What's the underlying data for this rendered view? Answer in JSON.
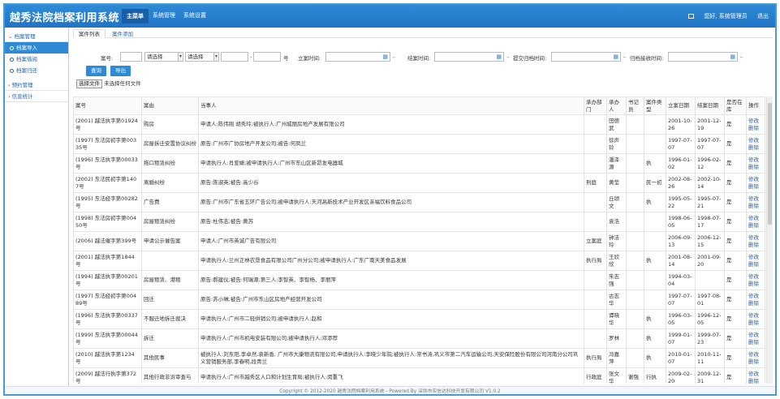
{
  "header": {
    "app_title": "越秀法院档案利用系统",
    "nav": [
      "主菜单",
      "系统管理",
      "系统设置"
    ],
    "greeting": "您好, 系统管理员",
    "logout": "退出"
  },
  "sidebar": {
    "group1": "档案管理",
    "items": [
      "档案导入",
      "档案借阅",
      "档案归还"
    ],
    "group2": "预约管理",
    "group3": "信息统计"
  },
  "tabs": [
    "案件列表",
    "案件添加"
  ],
  "filters": {
    "case_no_label": "案号:",
    "select1": "请选择",
    "select2": "请选择",
    "dash": "-",
    "hao": "号",
    "filing_time_label": "立案时间:",
    "closing_time_label": "结案时间:",
    "submit_archive_label": "提交归档时间:",
    "archive_receive_label": "归档接收时间:",
    "range_sep": "-",
    "query_button": "查询",
    "export_button": "导出"
  },
  "upload": {
    "choose_file": "选择文件",
    "no_file": "未选择任何文件"
  },
  "table": {
    "headers": [
      "案号",
      "案由",
      "当事人",
      "承办部门",
      "承办人",
      "书记员",
      "案件类型",
      "立案日期",
      "结案日期",
      "是否在库",
      "操作"
    ],
    "rows": [
      [
        "(2001) 越法执字第01924号",
        "购房",
        "申请人:陈伟刚 胡秀玲;被执行人:广州城丽房地产发展有限公司",
        "",
        "田德武",
        "",
        "",
        "2001-10-26",
        "2001-12-19",
        "是",
        "修改 删除"
      ],
      [
        "(1997) 东法房初字第00335号",
        "房屋拆迁安置协议纠纷",
        "原告:广州市广协房地产开发公司;被告:何凤兰",
        "",
        "徐声铃",
        "",
        "",
        "1997-07-07",
        "1997-07-07",
        "是",
        "修改 删除"
      ],
      [
        "(1996) 东法执字第00033号",
        "拖口租赁纠纷",
        "申请执行人:肖爱婕;被申请执行人:广州市东山区新昂发电器城",
        "",
        "潘泽源",
        "",
        "执",
        "1996-01-02",
        "1996-02-12",
        "是",
        "修改 删除"
      ],
      [
        "(2002) 东法民初字第1407号",
        "离婚纠纷",
        "原告:陈淑英;被告:高少谷",
        "刑庭",
        "黄莹",
        "",
        "民一初",
        "2002-08-26",
        "2002-10-14",
        "是",
        "修改 删除"
      ],
      [
        "(1995) 东法经字第00282号",
        "广告费",
        "原告:广州市广东省五环广告公司;被申请执行人:天河高新技术产业开发区亲福饮料食品公司",
        "",
        "丘颂文",
        "",
        "执",
        "1995-05-22",
        "1995-07-21",
        "是",
        "修改 删除"
      ],
      [
        "(1998) 东法房初字第00450号",
        "房屋租赁纠纷",
        "原告:杜伟志;被告:黄苏",
        "",
        "袁浩",
        "",
        "",
        "1998-06-05",
        "1998-07-17",
        "是",
        "修改 删除"
      ],
      [
        "(2006) 越法催字第399号",
        "申请公示催告案",
        "申请人:广州市英诚广告有限公司",
        "立案庭",
        "钟洁玲",
        "",
        "",
        "2006-09-13",
        "2006-12-15",
        "是",
        "修改 删除"
      ],
      [
        "(2001) 越法执字第1844号",
        "",
        "申请执行人:兰州正林农垦食品有限公司广州分公司;被申请执行人:广东广南天美食品发展",
        "执行局",
        "王欣欣",
        "",
        "执",
        "2001-08-14",
        "2001-09-20",
        "是",
        "修改 删除"
      ],
      [
        "(1994) 越法执字第00201号",
        "房屋租赁、港租",
        "原告:郝建仪;被告:何瑞源;第三人:李智英、李智杨、李丽萍",
        "",
        "朱志强",
        "",
        "",
        "1994-03-04",
        "",
        "是",
        "修改 删除"
      ],
      [
        "(1997) 东法经初字第00489号",
        "回迁",
        "原告:苏小琳;被告:广州市东山区房地产经营开发公司",
        "",
        "古志华",
        "",
        "",
        "1997-07-07",
        "1997-08-01",
        "是",
        "修改 删除"
      ],
      [
        "(1996) 东法执字第00337号",
        "不服迁地拆迁裁决",
        "申请执行人:广州市二轻供销公司;被申请执行人:赵和",
        "",
        "谭晓华",
        "",
        "执",
        "1996-03-05",
        "1996-12-05",
        "是",
        "修改 删除"
      ],
      [
        "(1999) 东法执字第00044号",
        "拆迁",
        "申请执行人:广州市机电安装有限公司;被申请执行人:邓添荐",
        "",
        "罗林",
        "",
        "执",
        "1999-01-07",
        "1999-07-23",
        "是",
        "修改 删除"
      ],
      [
        "(2010) 越法执字第1234号",
        "其他民事",
        "被执行人:刘东阳,李卓然,袁新香, 广州市大康物流有限公司;申请执行人:李晓少年院;被执行人:常书涛,巩义市第二汽车运输公司,天安保险股份有限公司河南分公司巩义营销服务部,李春明,段青兰",
        "执行局",
        "冯嘉萍",
        "",
        "执",
        "2010-01-07",
        "2010-11-11",
        "是",
        "修改 删除"
      ],
      [
        "(2009) 越法行执字第372号",
        "其他行政非诉审查与",
        "申请执行人:广州市越秀区人口和计划生育局;被执行人:闵重飞",
        "行政庭",
        "张文华",
        "谢强",
        "行执",
        "2009-02-20",
        "2009-12-31",
        "是",
        "修改 删除"
      ]
    ]
  },
  "footer": "Copyright © 2012-2020 越秀法院档案利用系统 - Powered By 深圳市实信达科技开发有限公司 V1.0.2"
}
